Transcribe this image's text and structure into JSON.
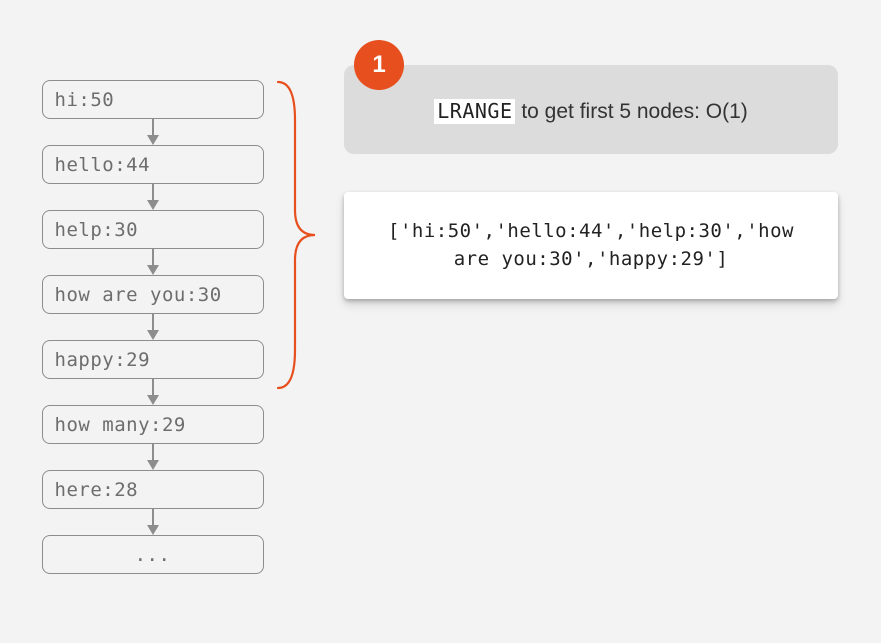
{
  "step": {
    "number": "1",
    "command": "LRANGE",
    "caption_rest": " to get first 5 nodes: O(1)"
  },
  "list": [
    "hi:50",
    "hello:44",
    "help:30",
    "how are you:30",
    "happy:29",
    "how many:29",
    "here:28",
    "..."
  ],
  "bracket_count": 5,
  "result": "['hi:50','hello:44','help:30','how are you:30','happy:29']"
}
